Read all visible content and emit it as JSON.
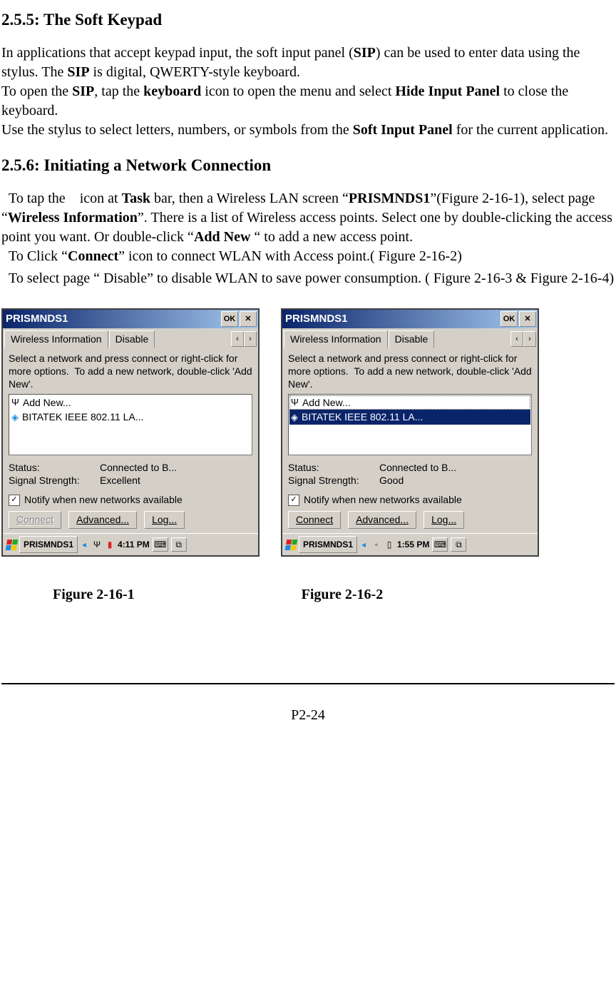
{
  "heading255": "2.5.5: The Soft Keypad",
  "p255": {
    "t1a": "In applications that accept keypad input, the soft input panel (",
    "sip1": "SIP",
    "t1b": ") can be used to enter data using the stylus. The ",
    "sip2": "SIP",
    "t1c": " is digital, QWERTY-style keyboard.",
    "t2a": "To open the ",
    "sip3": "SIP",
    "t2b": ", tap the ",
    "kbd": "keyboard",
    "t2c": " icon to open the menu and select ",
    "hide": "Hide Input Panel",
    "t2d": " to close the keyboard.",
    "t3a": "Use the stylus to select letters, numbers, or symbols from the ",
    "sip_panel": "Soft Input Panel",
    "t3b": " for the current application."
  },
  "heading256": "2.5.6: Initiating a Network Connection",
  "p256": {
    "l1a": "  To tap the    icon at ",
    "task": "Task",
    "l1b": " bar, then a Wireless LAN screen “",
    "prism": "PRISMNDS1",
    "l1c": "”(Figure 2-16-1), select page “",
    "wi": "Wireless Information",
    "l1d": "”. There is a list of Wireless access points. Select one by double-clicking the access point you want. Or double-click “",
    "addnew": "Add New",
    "l1e": " “ to add a new access point.",
    "l2a": "  To Click “",
    "connect": "Connect",
    "l2b": "” icon to connect WLAN with Access point.( Figure 2-16-2)",
    "l3": "  To select page “ Disable” to disable WLAN to save power consumption. ( Figure 2-16-3 & Figure 2-16-4)"
  },
  "ss": {
    "title": "PRISMNDS1",
    "ok": "OK",
    "close": "✕",
    "tab_wi": "Wireless Information",
    "tab_dis": "Disable",
    "left": "‹",
    "right": "›",
    "msg": "Select a network and press connect or right-click for more options.  To add a new network, double-click 'Add New'.",
    "addnew": "Add New...",
    "ap": "BITATEK IEEE 802.11 LA...",
    "status_lbl": "Status:",
    "status_val": "Connected to B...",
    "sig_lbl": "Signal Strength:",
    "sig_excellent": "Excellent",
    "sig_good": "Good",
    "check": "✓",
    "notify": "Notify when new networks available",
    "btn_connect": "Connect",
    "btn_adv": "Advanced...",
    "btn_log": "Log...",
    "task_prism": "PRISMNDS1",
    "time1": "4:11 PM",
    "time2": "1:55 PM"
  },
  "captions": {
    "c1": "Figure 2-16-1",
    "c2": "Figure 2-16-2"
  },
  "page": "P2-24"
}
